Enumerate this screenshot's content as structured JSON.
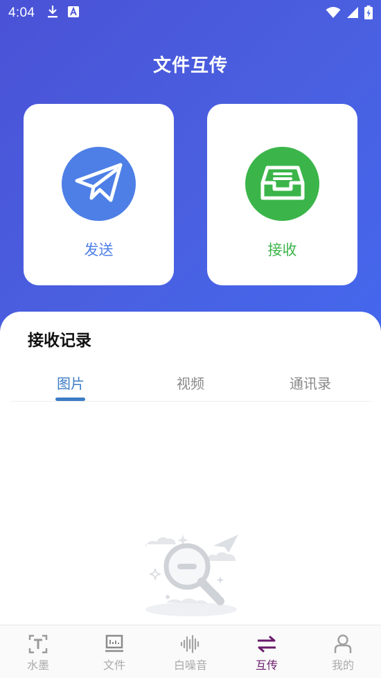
{
  "status_bar": {
    "time": "4:04",
    "icons_left": [
      "download-icon",
      "a-icon"
    ],
    "icons_right": [
      "wifi-icon",
      "signal-icon",
      "battery-icon"
    ]
  },
  "header": {
    "title": "文件互传"
  },
  "actions": {
    "send": {
      "label": "发送",
      "icon": "paper-plane-icon",
      "color": "#4d7fe6"
    },
    "receive": {
      "label": "接收",
      "icon": "inbox-tray-icon",
      "color": "#3bb54a"
    }
  },
  "records": {
    "title": "接收记录",
    "tabs": [
      {
        "label": "图片",
        "active": true
      },
      {
        "label": "视频",
        "active": false
      },
      {
        "label": "通讯录",
        "active": false
      }
    ],
    "empty_illustration": "empty-search-icon"
  },
  "bottom_nav": {
    "items": [
      {
        "label": "水墨",
        "icon": "text-icon",
        "active": false
      },
      {
        "label": "文件",
        "icon": "file-panel-icon",
        "active": false
      },
      {
        "label": "白噪音",
        "icon": "sound-wave-icon",
        "active": false
      },
      {
        "label": "互传",
        "icon": "transfer-arrows-icon",
        "active": true
      },
      {
        "label": "我的",
        "icon": "person-icon",
        "active": false
      }
    ]
  },
  "colors": {
    "hero_gradient_start": "#4a52d6",
    "hero_gradient_end": "#4468ee",
    "tab_active": "#3b7cc4",
    "nav_active": "#6a1b6b"
  }
}
